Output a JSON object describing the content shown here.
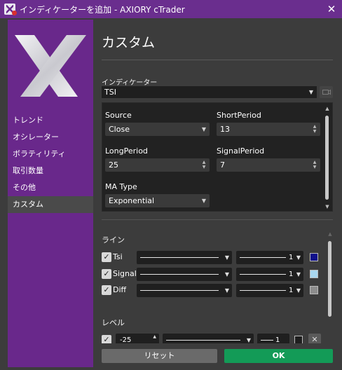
{
  "window": {
    "title": "インディケーターを追加 - AXIORY cTrader",
    "close_glyph": "✕"
  },
  "sidebar": {
    "items": [
      {
        "label": "トレンド",
        "active": false
      },
      {
        "label": "オシレーター",
        "active": false
      },
      {
        "label": "ボラティリティ",
        "active": false
      },
      {
        "label": "取引数量",
        "active": false
      },
      {
        "label": "その他",
        "active": false
      },
      {
        "label": "カスタム",
        "active": true
      }
    ]
  },
  "main": {
    "title": "カスタム",
    "indicator_label": "インディケーター",
    "indicator_value": "TSI",
    "params": {
      "source_label": "Source",
      "source_value": "Close",
      "short_label": "ShortPeriod",
      "short_value": "13",
      "long_label": "LongPeriod",
      "long_value": "25",
      "signal_label": "SignalPeriod",
      "signal_value": "7",
      "ma_label": "MA Type",
      "ma_value": "Exponential"
    },
    "lines_label": "ライン",
    "lines": [
      {
        "name": "Tsi",
        "checked": true,
        "width": "1",
        "color": "#10108a"
      },
      {
        "name": "Signal",
        "checked": true,
        "width": "1",
        "color": "#a9d7ef"
      },
      {
        "name": "Diff",
        "checked": true,
        "width": "1",
        "color": "#8c8c8c"
      }
    ],
    "levels_label": "レベル",
    "level_value": "-25",
    "level_width": "1",
    "check_glyph": "✓"
  },
  "footer": {
    "reset_label": "リセット",
    "ok_label": "OK"
  },
  "colors": {
    "titlebar": "#6a2e8e",
    "sidebar": "#69288b",
    "ok_button": "#139b57"
  }
}
